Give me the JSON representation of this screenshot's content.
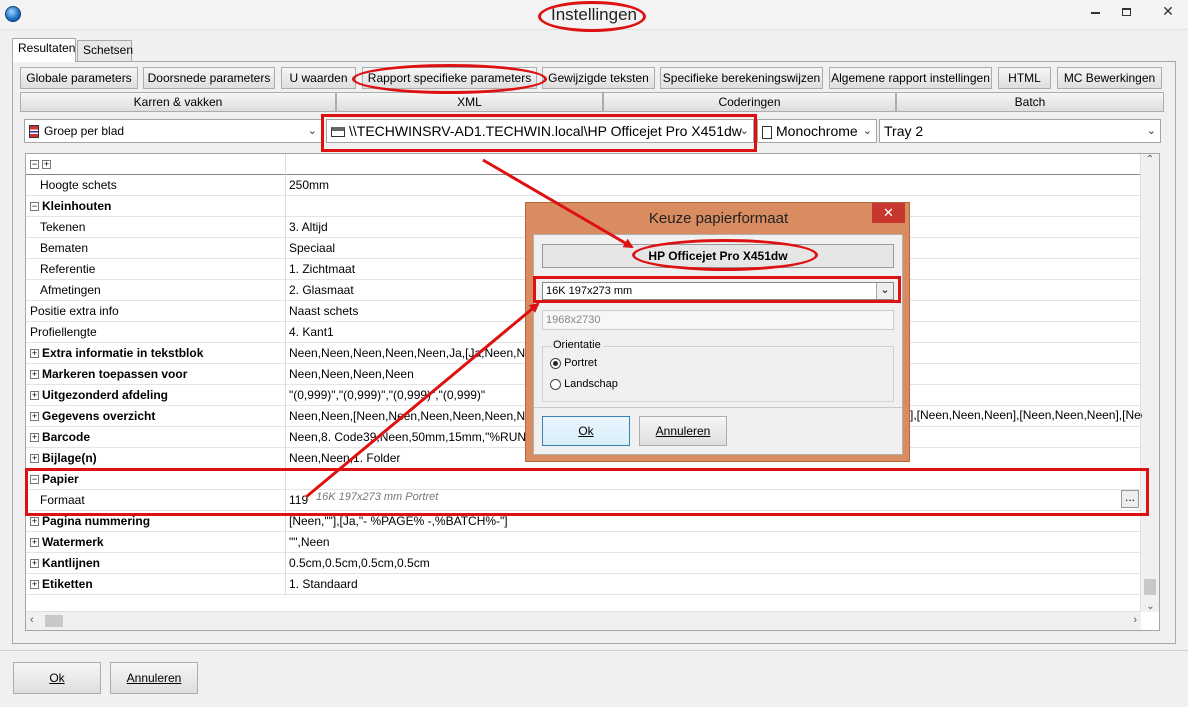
{
  "window": {
    "title": "Instellingen"
  },
  "tabs": [
    "Resultaten",
    "Schetsen"
  ],
  "toolbar_row1": [
    "Globale parameters",
    "Doorsnede parameters",
    "U waarden",
    "Rapport specifieke parameters",
    "Gewijzigde teksten",
    "Specifieke berekeningswijzen",
    "Algemene rapport instellingen",
    "HTML",
    "MC Bewerkingen"
  ],
  "toolbar_row2": [
    "Karren & vakken",
    "XML",
    "Coderingen",
    "Batch"
  ],
  "combos": {
    "group": "Groep per blad",
    "printer": "\\\\TECHWINSRV-AD1.TECHWIN.local\\HP Officejet Pro X451dw",
    "color": "Monochrome",
    "tray": "Tray 2"
  },
  "grid": {
    "header_controls": [
      "−",
      "+"
    ],
    "rows": [
      {
        "name": "Hoogte schets",
        "value": "250mm",
        "indent": true,
        "bold": false,
        "exp": ""
      },
      {
        "name": "Kleinhouten",
        "value": "",
        "indent": false,
        "bold": true,
        "exp": "−"
      },
      {
        "name": "Tekenen",
        "value": "3. Altijd",
        "indent": true,
        "bold": false,
        "exp": ""
      },
      {
        "name": "Bematen",
        "value": "Speciaal",
        "indent": true,
        "bold": false,
        "exp": ""
      },
      {
        "name": "Referentie",
        "value": "1. Zichtmaat",
        "indent": true,
        "bold": false,
        "exp": ""
      },
      {
        "name": "Afmetingen",
        "value": "2. Glasmaat",
        "indent": true,
        "bold": false,
        "exp": ""
      },
      {
        "name": "Positie extra info",
        "value": "Naast schets",
        "indent": false,
        "bold": false,
        "exp": ""
      },
      {
        "name": "Profiellengte",
        "value": "4. Kant1",
        "indent": false,
        "bold": false,
        "exp": ""
      },
      {
        "name": "Extra informatie in tekstblok",
        "value": "Neen,Neen,Neen,Neen,Neen,Ja,[Ja,Neen,Neen,N",
        "indent": false,
        "bold": true,
        "exp": "+"
      },
      {
        "name": "Markeren toepassen voor",
        "value": "Neen,Neen,Neen,Neen",
        "indent": false,
        "bold": true,
        "exp": "+"
      },
      {
        "name": "Uitgezonderd afdeling",
        "value": "\"(0,999)\",\"(0,999)\",\"(0,999)\",\"(0,999)\"",
        "indent": false,
        "bold": true,
        "exp": "+"
      },
      {
        "name": "Gegevens overzicht",
        "value": "Neen,Neen,[Neen,Neen,Neen,Neen,Neen,Neen,N",
        "indent": false,
        "bold": true,
        "exp": "+"
      },
      {
        "name": "Barcode",
        "value": "Neen,8. Code39,Neen,50mm,15mm,\"%RUNTAG%",
        "indent": false,
        "bold": true,
        "exp": "+"
      },
      {
        "name": "Bijlage(n)",
        "value": "Neen,Neen,1. Folder",
        "indent": false,
        "bold": true,
        "exp": "+"
      },
      {
        "name": "Papier",
        "value": "",
        "indent": false,
        "bold": true,
        "exp": "−"
      },
      {
        "name": "Formaat",
        "value": "119",
        "indent": true,
        "bold": false,
        "exp": ""
      },
      {
        "name": "Pagina nummering",
        "value": "[Neen,\"\"],[Ja,\"- %PAGE% -,%BATCH%-\"]",
        "indent": false,
        "bold": true,
        "exp": "+"
      },
      {
        "name": "Watermerk",
        "value": "\"\",Neen",
        "indent": false,
        "bold": true,
        "exp": "+"
      },
      {
        "name": "Kantlijnen",
        "value": "0.5cm,0.5cm,0.5cm,0.5cm",
        "indent": false,
        "bold": true,
        "exp": "+"
      },
      {
        "name": "Etiketten",
        "value": "1. Standaard",
        "indent": false,
        "bold": true,
        "exp": "+"
      }
    ],
    "gegevens_tail": "],[Neen,Neen,Neen],[Neen,Neen,Neen],[Neen,N",
    "formaat_hint": "16K 197x273 mm Portret",
    "ellipsis": "..."
  },
  "dialog": {
    "title": "Keuze papierformaat",
    "printer_name": "HP Officejet Pro X451dw",
    "paper_size": "16K 197x273 mm",
    "pixels": "1968x2730",
    "orientation_label": "Orientatie",
    "options": [
      "Portret",
      "Landschap"
    ],
    "selected": "Portret",
    "ok": "Ok",
    "cancel": "Annuleren"
  },
  "footer": {
    "ok": "Ok",
    "cancel": "Annuleren"
  }
}
